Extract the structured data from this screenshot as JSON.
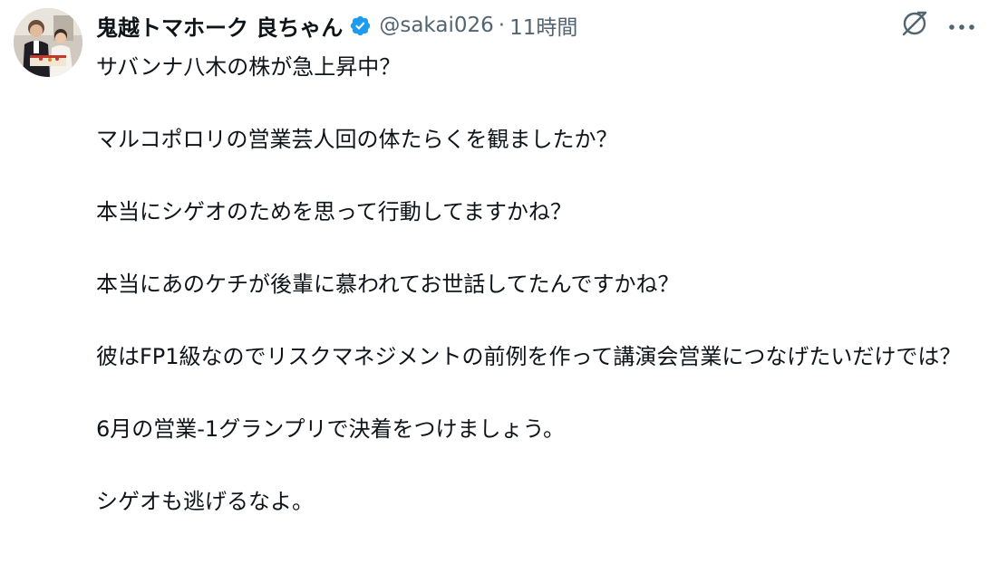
{
  "tweet": {
    "display_name": "鬼越トマホーク 良ちゃん",
    "handle": "@sakai026",
    "separator": "·",
    "time": "11時間",
    "avatar_icon": "user-avatar-photo",
    "verified_icon": "verified-badge-icon",
    "verified_color": "#1d9bf0",
    "grok_icon": "grok-icon",
    "more_icon": "more-options-icon",
    "paragraphs": [
      "サバンナ八木の株が急上昇中？",
      "マルコポロリの営業芸人回の体たらくを観ましたか？",
      "本当にシゲオのためを思って行動してますかね？",
      "本当にあのケチが後輩に慕われてお世話してたんですかね？",
      "彼はFP1級なのでリスクマネジメントの前例を作って講演会営業につなげたいだけでは？",
      "6月の営業-1グランプリで決着をつけましょう。",
      "シゲオも逃げるなよ。"
    ]
  }
}
